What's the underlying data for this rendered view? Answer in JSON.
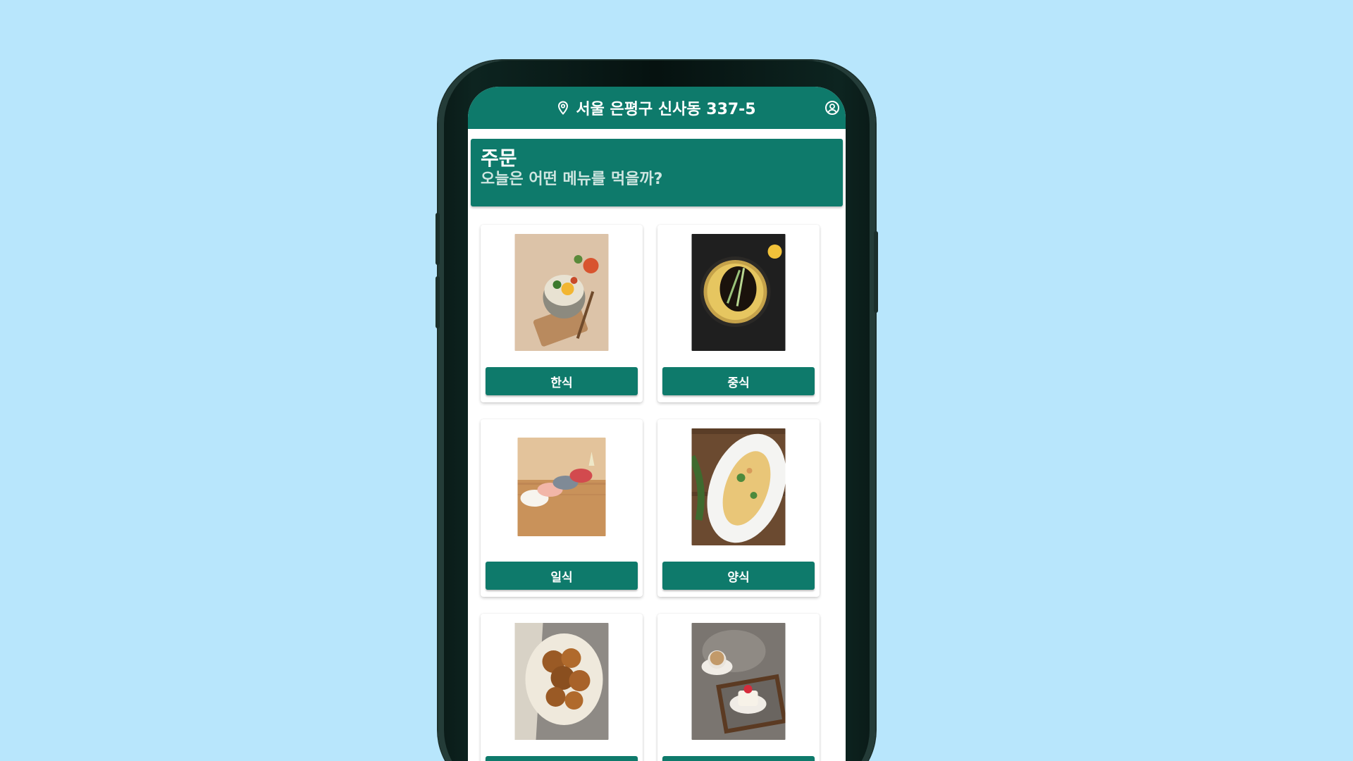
{
  "header": {
    "location": "서울 은평구 신사동 337-5",
    "location_icon": "map-pin-icon",
    "profile_icon": "user-circle-icon"
  },
  "hero": {
    "title": "주문",
    "subtitle": "오늘은 어떤 메뉴를 먹을까?"
  },
  "categories": [
    {
      "label": "한식",
      "image": "bibimbap-photo"
    },
    {
      "label": "중식",
      "image": "jajangmyeon-photo"
    },
    {
      "label": "일식",
      "image": "sushi-photo"
    },
    {
      "label": "양식",
      "image": "pasta-photo"
    },
    {
      "label": "",
      "image": "fried-chicken-photo"
    },
    {
      "label": "",
      "image": "cafe-dessert-photo"
    }
  ],
  "colors": {
    "accent": "#0e7a6b",
    "background": "#b8e6fc",
    "subtitle": "#cfe6e1"
  }
}
